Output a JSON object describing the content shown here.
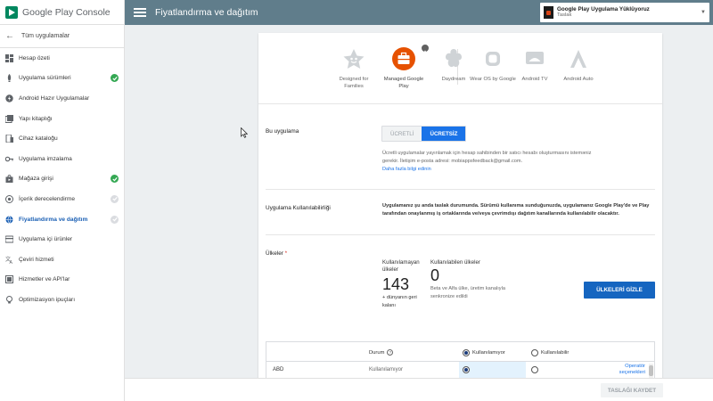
{
  "brand": {
    "name": "Google Play Console",
    "logo_icon": "play-console-icon"
  },
  "header": {
    "title": "Fiyatlandırma ve dağıtım",
    "menu_icon": "menu-icon",
    "app": {
      "name": "Google Play Uygulama Yüklüyoruz",
      "status": "Taslak",
      "caret": "▼"
    }
  },
  "sidebar": {
    "back_label": "Tüm uygulamalar",
    "back_icon": "arrow-left-icon",
    "items": [
      {
        "label": "Hesap özeti",
        "icon": "dashboard-icon",
        "status": ""
      },
      {
        "label": "Uygulama sürümleri",
        "icon": "rocket-icon",
        "status": "complete"
      },
      {
        "label": "Android Hazır Uygulamalar",
        "icon": "instant-app-icon",
        "status": ""
      },
      {
        "label": "Yapı kitaplığı",
        "icon": "library-icon",
        "status": ""
      },
      {
        "label": "Cihaz kataloğu",
        "icon": "device-icon",
        "status": ""
      },
      {
        "label": "Uygulama imzalama",
        "icon": "key-icon",
        "status": ""
      },
      {
        "label": "Mağaza girişi",
        "icon": "store-icon",
        "status": "complete"
      },
      {
        "label": "İçerik derecelendirme",
        "icon": "rating-icon",
        "status": "pending"
      },
      {
        "label": "Fiyatlandırma ve dağıtım",
        "icon": "globe-icon",
        "status": "pending",
        "active": true
      },
      {
        "label": "Uygulama içi ürünler",
        "icon": "card-icon",
        "status": ""
      },
      {
        "label": "Çeviri hizmeti",
        "icon": "translate-icon",
        "status": ""
      },
      {
        "label": "Hizmetler ve API'lar",
        "icon": "api-icon",
        "status": ""
      },
      {
        "label": "Optimizasyon ipuçları",
        "icon": "bulb-icon",
        "status": ""
      }
    ]
  },
  "devices": [
    {
      "label": "Designed for Families",
      "icon": "families-icon",
      "selected": false
    },
    {
      "label": "Managed Google Play",
      "icon": "briefcase-icon",
      "selected": true
    },
    {
      "label": "Daydream",
      "icon": "daydream-icon",
      "selected": false
    },
    {
      "label": "Wear OS by Google",
      "icon": "watch-icon",
      "selected": false
    },
    {
      "label": "Android TV",
      "icon": "tv-icon",
      "selected": false
    },
    {
      "label": "Android Auto",
      "icon": "auto-icon",
      "selected": false
    }
  ],
  "pricing": {
    "label": "Bu uygulama",
    "paid": "ÜCRETLİ",
    "free": "ÜCRETSİZ",
    "selected": "free",
    "desc": "Ücretli uygulamalar yayınlamak için hesap sahibinden bir satıcı hesabı oluşturmasını isteməniz gerekir. İletişim e-posta adresi: mobiappsfeedback@gmail.com.",
    "link": "Daha fazla bilgi edinin"
  },
  "availability": {
    "label": "Uygulama Kullanılabilirliği",
    "text": "Uygulamanız şu anda taslak durumunda. Sürümü kullanıma sunduğunuzda, uygulamanız Google Play'de ve Play tarafından onaylanmış iş ortaklarında ve/veya çevrimdışı dağıtım kanallarında kullanılabilir olacaktır."
  },
  "countries": {
    "label": "Ülkeler",
    "required_mark": "*",
    "unavailable_head": "Kullanılamayan ülkeler",
    "unavailable_count": "143",
    "unavailable_sub": "+ dünyanın geri kalanı",
    "available_head": "Kullanılabilen ülkeler",
    "available_count": "0",
    "available_sub": "Beta ve Alfa ülke, üretim kanalıyla senkronize edildi",
    "show_button": "ÜLKELERİ GİZLE"
  },
  "table": {
    "col_status": "Durum",
    "col_unavailable": "Kullanılamıyor",
    "col_available": "Kullanılabilir",
    "header_selected": "unavailable",
    "rows": [
      {
        "country": "ABD",
        "status": "Kullanılamıyor",
        "selected": "unavailable",
        "operators": "Operatör seçenekleri"
      }
    ]
  },
  "footer": {
    "save_label": "TASLAĞI KAYDET"
  }
}
